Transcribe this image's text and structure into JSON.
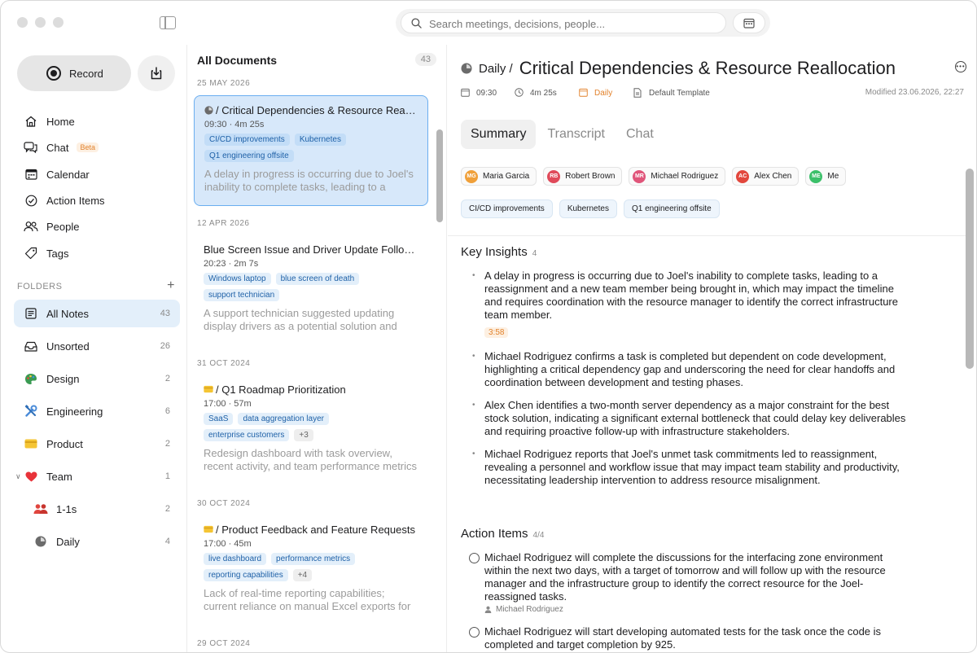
{
  "search": {
    "placeholder": "Search meetings, decisions, people..."
  },
  "sidebar": {
    "record_label": "Record",
    "nav": [
      {
        "label": "Home",
        "icon": "home-icon"
      },
      {
        "label": "Chat",
        "icon": "chat-icon",
        "badge": "Beta"
      },
      {
        "label": "Calendar",
        "icon": "calendar-icon"
      },
      {
        "label": "Action Items",
        "icon": "check-circle-icon"
      },
      {
        "label": "People",
        "icon": "people-icon"
      },
      {
        "label": "Tags",
        "icon": "tag-icon"
      }
    ],
    "folders_header": "FOLDERS",
    "folders": [
      {
        "label": "All Notes",
        "count": "43",
        "icon": "notes-icon"
      },
      {
        "label": "Unsorted",
        "count": "26",
        "icon": "tray-icon"
      },
      {
        "label": "Design",
        "count": "2",
        "icon": "palette-icon"
      },
      {
        "label": "Engineering",
        "count": "6",
        "icon": "tools-icon"
      },
      {
        "label": "Product",
        "count": "2",
        "icon": "card-icon"
      },
      {
        "label": "Team",
        "count": "1",
        "icon": "heart-icon"
      },
      {
        "label": "1-1s",
        "count": "2",
        "icon": "people-icon"
      },
      {
        "label": "Daily",
        "count": "4",
        "icon": "clock-icon"
      }
    ]
  },
  "list": {
    "title": "All Documents",
    "count": "43",
    "groups": [
      {
        "date": "25 MAY 2026",
        "item": {
          "title": "/ Critical Dependencies & Resource Reallocation",
          "meta": "09:30 · 4m 25s",
          "tags": [
            "CI/CD improvements",
            "Kubernetes",
            "Q1 engineering offsite"
          ],
          "snippet": "A delay in progress is occurring due to Joel's inability to complete tasks, leading to a reassignment"
        }
      },
      {
        "date": "12 APR 2026",
        "item": {
          "title": "Blue Screen Issue and Driver Update Follow-up",
          "meta": "20:23 · 2m 7s",
          "tags": [
            "Windows laptop",
            "blue screen of death",
            "support technician"
          ],
          "snippet": "A support technician suggested updating display drivers as a potential solution and follow-up"
        }
      },
      {
        "date": "31 OCT 2024",
        "item": {
          "title": "/ Q1 Roadmap Prioritization",
          "meta": "17:00 · 57m",
          "tags": [
            "SaaS",
            "data aggregation layer",
            "enterprise customers",
            "+3"
          ],
          "snippet": "Redesign dashboard with task overview, recent activity, and team performance metrics"
        }
      },
      {
        "date": "30 OCT 2024",
        "item": {
          "title": "/ Product Feedback and Feature Requests",
          "meta": "17:00 · 45m",
          "tags": [
            "live dashboard",
            "performance metrics",
            "reporting capabilities",
            "+4"
          ],
          "snippet": "Lack of real-time reporting capabilities; current reliance on manual Excel exports for reporting"
        }
      },
      {
        "date": "29 OCT 2024"
      }
    ]
  },
  "detail": {
    "crumb": "Daily /",
    "title": "Critical Dependencies & Resource Reallocation",
    "time": "09:30",
    "duration": "4m 25s",
    "folder": "Daily",
    "template": "Default Template",
    "modified": "Modified 23.06.2026, 22:27",
    "tabs": [
      "Summary",
      "Transcript",
      "Chat"
    ],
    "people": [
      {
        "initials": "MG",
        "name": "Maria Garcia",
        "color": "#f0a03a"
      },
      {
        "initials": "RB",
        "name": "Robert Brown",
        "color": "#e04a5a"
      },
      {
        "initials": "MR",
        "name": "Michael Rodriguez",
        "color": "#e0557a"
      },
      {
        "initials": "AC",
        "name": "Alex Chen",
        "color": "#e2473d"
      },
      {
        "initials": "ME",
        "name": "Me",
        "color": "#3cc06a"
      }
    ],
    "tags": [
      "CI/CD improvements",
      "Kubernetes",
      "Q1 engineering offsite"
    ],
    "insights_title": "Key Insights",
    "insights_count": "4",
    "insights": [
      "A delay in progress is occurring due to Joel's inability to complete tasks, leading to a reassignment and a new team member being brought in, which may impact the timeline and requires coordination with the resource manager to identify the correct infrastructure team member.",
      "Michael Rodriguez confirms a task is completed but dependent on code development, highlighting a critical dependency gap and underscoring the need for clear handoffs and coordination between development and testing phases.",
      "Alex Chen identifies a two-month server dependency as a major constraint for the best stock solution, indicating a significant external bottleneck that could delay key deliverables and requiring proactive follow-up with infrastructure stakeholders.",
      "Michael Rodriguez reports that Joel's unmet task commitments led to reassignment, revealing a personnel and workflow issue that may impact team stability and productivity, necessitating leadership intervention to address resource misalignment."
    ],
    "insight_timestamp": "3:58",
    "actions_title": "Action Items",
    "actions_count": "4/4",
    "actions": [
      "Michael Rodriguez will complete the discussions for the interfacing zone environment within the next two days, with a target of tomorrow and will follow up with the resource manager and the infrastructure group to identify the correct resource for the Joel-reassigned tasks.",
      "Michael Rodriguez will start developing automated tests for the task once the code is completed and target completion by 925."
    ],
    "action_assignee": "Michael Rodriguez"
  }
}
